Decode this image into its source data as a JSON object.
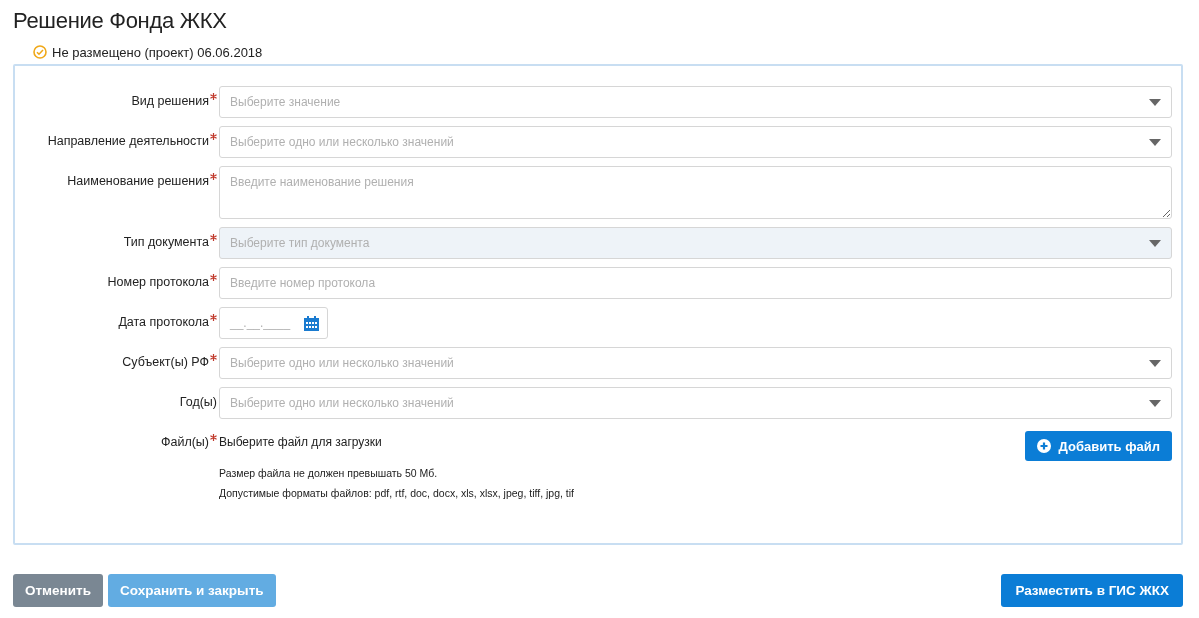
{
  "title": "Решение Фонда ЖКХ",
  "status": {
    "text": "Не размещено (проект) 06.06.2018"
  },
  "fields": [
    {
      "kind": "select",
      "label": "Вид решения",
      "required": true,
      "placeholder": "Выберите значение",
      "disabled": false
    },
    {
      "kind": "select",
      "label": "Направление деятельности",
      "required": true,
      "placeholder": "Выберите одно или несколько значений",
      "disabled": false
    },
    {
      "kind": "textarea",
      "label": "Наименование решения",
      "required": true,
      "placeholder": "Введите наименование решения",
      "disabled": false
    },
    {
      "kind": "select",
      "label": "Тип документа",
      "required": true,
      "placeholder": "Выберите тип документа",
      "disabled": true
    },
    {
      "kind": "input",
      "label": "Номер протокола",
      "required": true,
      "placeholder": "Введите номер протокола",
      "disabled": false
    },
    {
      "kind": "date",
      "label": "Дата протокола",
      "required": true,
      "placeholder": "__.__.____",
      "disabled": false
    },
    {
      "kind": "select",
      "label": "Субъект(ы) РФ",
      "required": true,
      "placeholder": "Выберите одно или несколько значений",
      "disabled": false
    },
    {
      "kind": "select",
      "label": "Год(ы)",
      "required": false,
      "placeholder": "Выберите одно или несколько значений",
      "disabled": false
    }
  ],
  "file": {
    "label": "Файл(ы)",
    "required": true,
    "prompt": "Выберите файл для загрузки",
    "button": "Добавить файл",
    "notes": [
      "Размер файла не должен превышать 50 Мб.",
      "Допустимые форматы файлов: pdf, rtf, doc, docx, xls, xlsx, jpeg, tiff, jpg, tif"
    ]
  },
  "buttons": [
    {
      "label": "Отменить",
      "kind": "cancel",
      "disabled": false
    },
    {
      "label": "Сохранить и закрыть",
      "kind": "save",
      "disabled": true
    },
    {
      "label": "Разместить в ГИС ЖКХ",
      "kind": "publish",
      "disabled": false
    }
  ]
}
